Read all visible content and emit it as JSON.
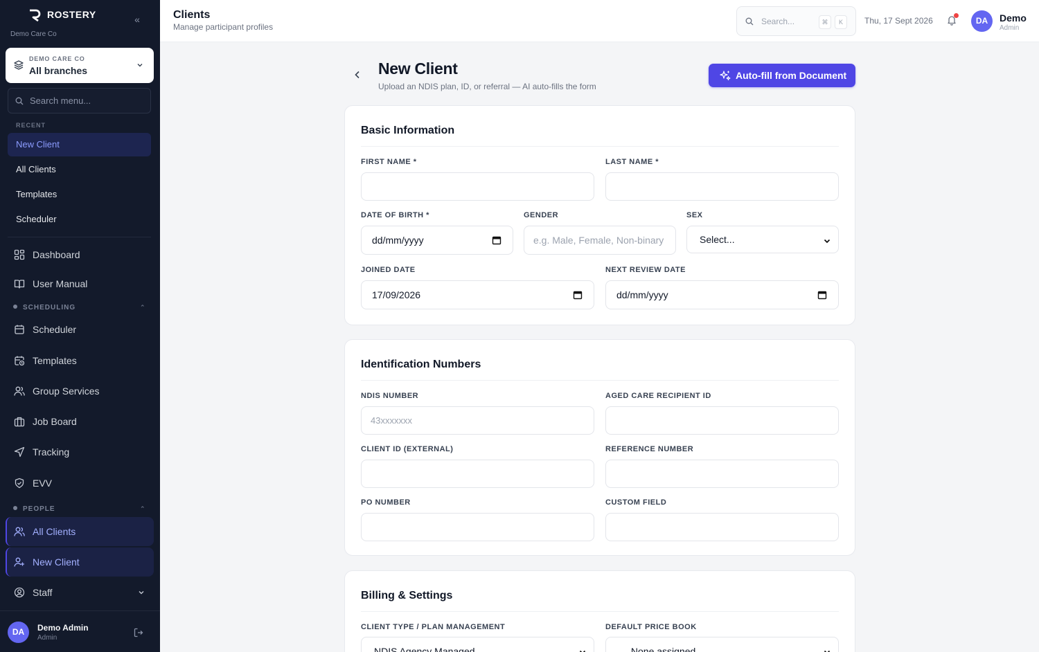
{
  "sidebar": {
    "brand": "ROSTERY",
    "org_name": "Demo Care Co",
    "branch": {
      "org_label": "DEMO CARE CO",
      "value": "All branches"
    },
    "search_placeholder": "Search menu...",
    "recent_label": "RECENT",
    "recent": [
      {
        "label": "New Client",
        "active": true
      },
      {
        "label": "All Clients"
      },
      {
        "label": "Templates"
      },
      {
        "label": "Scheduler"
      }
    ],
    "nav": [
      {
        "label": "Dashboard",
        "icon": "grid-icon"
      },
      {
        "label": "User Manual",
        "icon": "book-icon"
      }
    ],
    "scheduling_label": "SCHEDULING",
    "scheduling": [
      {
        "label": "Scheduler",
        "icon": "calendar-icon"
      },
      {
        "label": "Templates",
        "icon": "calendar-clock-icon"
      },
      {
        "label": "Group Services",
        "icon": "users-icon"
      },
      {
        "label": "Job Board",
        "icon": "briefcase-icon"
      },
      {
        "label": "Tracking",
        "icon": "navigation-icon"
      },
      {
        "label": "EVV",
        "icon": "shield-check-icon"
      }
    ],
    "people_label": "PEOPLE",
    "people": [
      {
        "label": "All Clients",
        "icon": "users-icon",
        "active": true
      },
      {
        "label": "New Client",
        "icon": "user-plus-icon",
        "active": true
      },
      {
        "label": "Staff",
        "icon": "user-circle-icon"
      }
    ],
    "user": {
      "initials": "DA",
      "name": "Demo Admin",
      "role": "Admin"
    }
  },
  "topbar": {
    "title": "Clients",
    "subtitle": "Manage participant profiles",
    "search_placeholder": "Search...",
    "kbd": [
      "⌘",
      "K"
    ],
    "date": "Thu, 17 Sept 2026",
    "user": {
      "initials": "DA",
      "name": "Demo",
      "role": "Admin"
    }
  },
  "header": {
    "title": "New Client",
    "subtitle": "Upload an NDIS plan, ID, or referral — AI auto-fills the form",
    "autofill_label": "Auto-fill from Document"
  },
  "basic": {
    "title": "Basic Information",
    "first_name_label": "FIRST NAME *",
    "last_name_label": "LAST NAME *",
    "dob_label": "DATE OF BIRTH *",
    "dob_value": "dd/mm/yyyy",
    "gender_label": "GENDER",
    "gender_placeholder": "e.g. Male, Female, Non-binary",
    "sex_label": "SEX",
    "sex_value": "Select...",
    "joined_label": "JOINED DATE",
    "joined_value": "17/09/2026",
    "review_label": "NEXT REVIEW DATE",
    "review_value": "dd/mm/yyyy"
  },
  "ids": {
    "title": "Identification Numbers",
    "ndis_label": "NDIS NUMBER",
    "ndis_placeholder": "43xxxxxxx",
    "aged_label": "AGED CARE RECIPIENT ID",
    "client_id_label": "CLIENT ID (EXTERNAL)",
    "reference_label": "REFERENCE NUMBER",
    "po_label": "PO NUMBER",
    "custom_label": "CUSTOM FIELD"
  },
  "billing": {
    "title": "Billing & Settings",
    "client_type_label": "CLIENT TYPE / PLAN MANAGEMENT",
    "client_type_value": "NDIS Agency Managed",
    "price_book_label": "DEFAULT PRICE BOOK",
    "price_book_value": "— None assigned —"
  },
  "colors": {
    "accent": "#4f46e5",
    "sidebar_bg": "#131a2b",
    "notification": "#ef4444"
  }
}
